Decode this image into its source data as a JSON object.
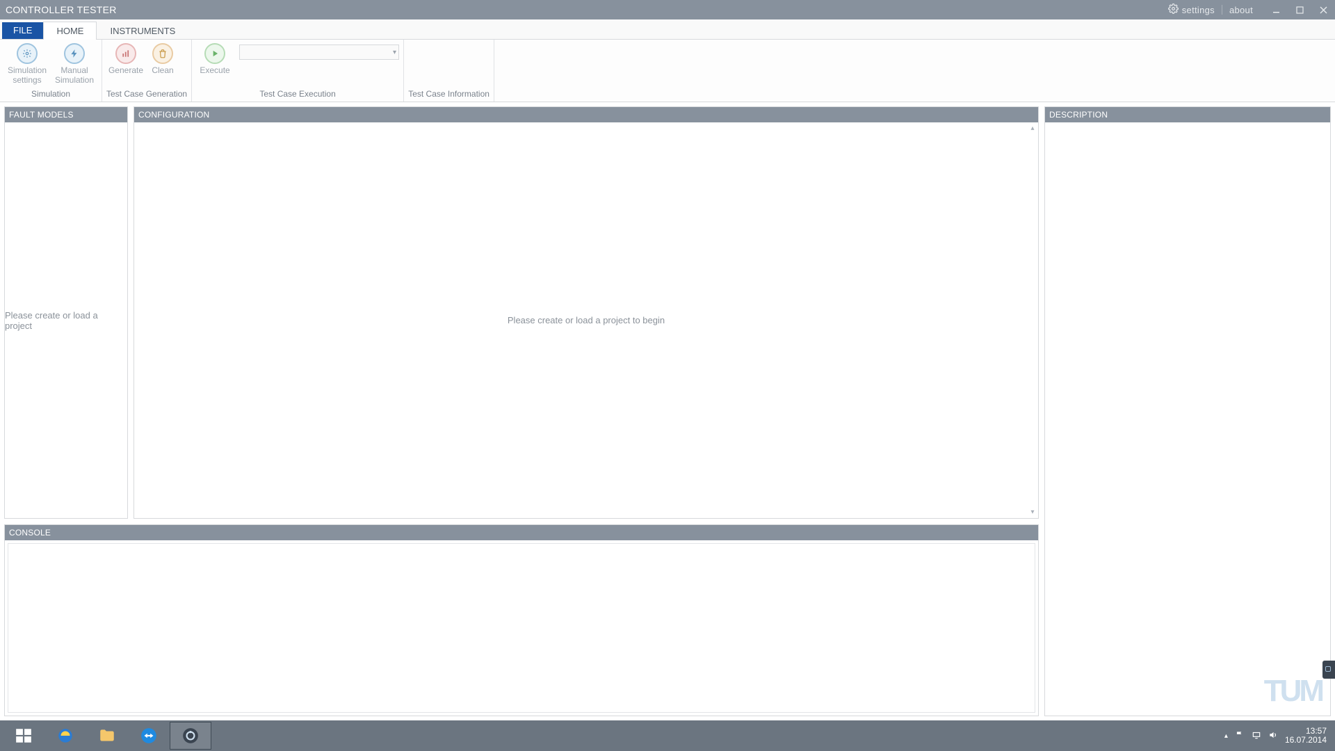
{
  "titlebar": {
    "title": "CONTROLLER TESTER",
    "settings_label": "settings",
    "about_label": "about"
  },
  "ribbon": {
    "file_label": "FILE",
    "tabs": [
      {
        "id": "home",
        "label": "HOME",
        "active": true
      },
      {
        "id": "instruments",
        "label": "INSTRUMENTS",
        "active": false
      }
    ],
    "groups": {
      "simulation": {
        "label": "Simulation",
        "sim_settings": "Simulation\nsettings",
        "manual_sim": "Manual\nSimulation"
      },
      "generation": {
        "label": "Test Case Generation",
        "generate": "Generate",
        "clean": "Clean"
      },
      "execution": {
        "label": "Test Case Execution",
        "execute": "Execute",
        "combo_value": ""
      },
      "information": {
        "label": "Test Case Information"
      }
    }
  },
  "panels": {
    "fault_models": {
      "title": "FAULT MODELS",
      "placeholder": "Please create or load a project"
    },
    "configuration": {
      "title": "CONFIGURATION",
      "placeholder": "Please create or load a project to begin"
    },
    "description": {
      "title": "DESCRIPTION"
    },
    "console": {
      "title": "CONSOLE"
    }
  },
  "taskbar": {
    "items": [
      {
        "name": "start",
        "active": false
      },
      {
        "name": "internet-explorer",
        "active": false
      },
      {
        "name": "file-explorer",
        "active": false
      },
      {
        "name": "teamviewer",
        "active": false
      },
      {
        "name": "controller-tester",
        "active": true
      }
    ],
    "clock_time": "13:57",
    "clock_date": "16.07.2014"
  },
  "brand": {
    "logo_text": "TUM"
  }
}
